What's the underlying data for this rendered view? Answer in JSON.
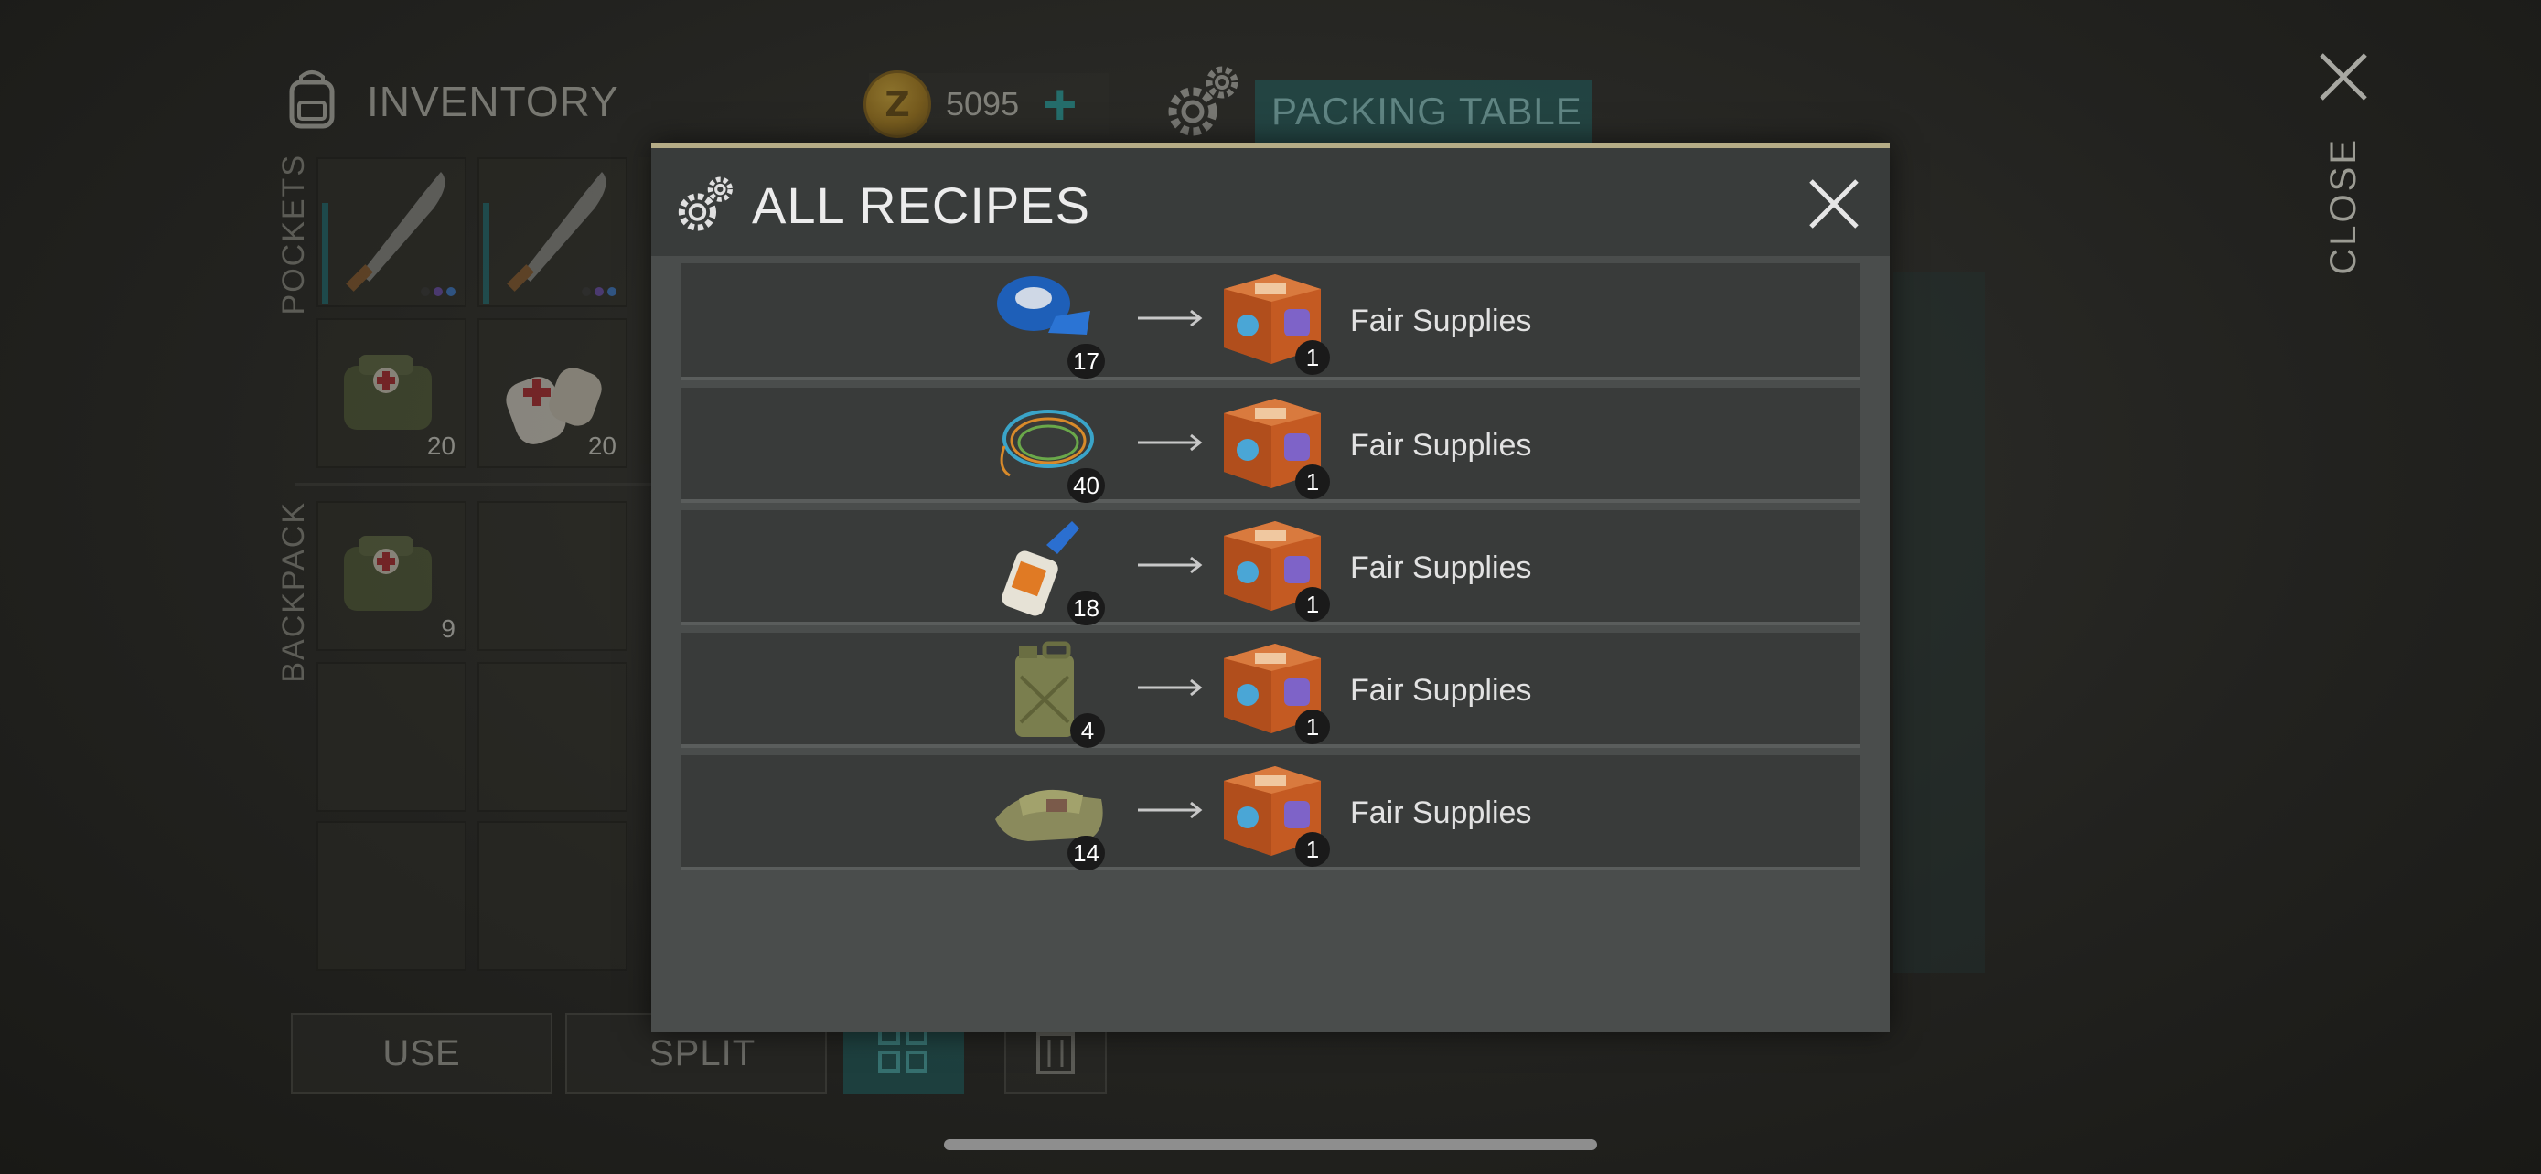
{
  "inventory": {
    "title": "INVENTORY",
    "pockets_label": "POCKETS",
    "backpack_label": "BACKPACK",
    "pocket_slots": [
      {
        "item": "machete-icon",
        "count": ""
      },
      {
        "item": "machete-icon",
        "count": ""
      },
      {
        "item": "medkit-bag-icon",
        "count": "20"
      },
      {
        "item": "bandage-icon",
        "count": "20"
      }
    ],
    "backpack_slots": [
      {
        "item": "medkit-bag-icon",
        "count": "9"
      }
    ]
  },
  "currency": {
    "amount": "5095",
    "coin_letter": "Z",
    "add_label": "+"
  },
  "station": {
    "name": "PACKING TABLE"
  },
  "actions": {
    "use_label": "USE",
    "split_label": "SPLIT"
  },
  "close": {
    "label": "CLOSE"
  },
  "modal": {
    "title": "ALL RECIPES",
    "recipes": [
      {
        "ingredient_icon": "duct-tape-icon",
        "ingredient_count": "17",
        "output_icon": "supply-crate-icon",
        "output_count": "1",
        "output_name": "Fair Supplies"
      },
      {
        "ingredient_icon": "wire-coil-icon",
        "ingredient_count": "40",
        "output_icon": "supply-crate-icon",
        "output_count": "1",
        "output_name": "Fair Supplies"
      },
      {
        "ingredient_icon": "glue-tube-icon",
        "ingredient_count": "18",
        "output_icon": "supply-crate-icon",
        "output_count": "1",
        "output_name": "Fair Supplies"
      },
      {
        "ingredient_icon": "jerry-can-icon",
        "ingredient_count": "4",
        "output_icon": "supply-crate-icon",
        "output_count": "1",
        "output_name": "Fair Supplies"
      },
      {
        "ingredient_icon": "cloth-icon",
        "ingredient_count": "14",
        "output_icon": "supply-crate-icon",
        "output_count": "1",
        "output_name": "Fair Supplies"
      }
    ]
  },
  "colors": {
    "accent_teal": "#1f5b5b",
    "modal_border": "#b5ac86",
    "coin_gold": "#c89a24"
  }
}
